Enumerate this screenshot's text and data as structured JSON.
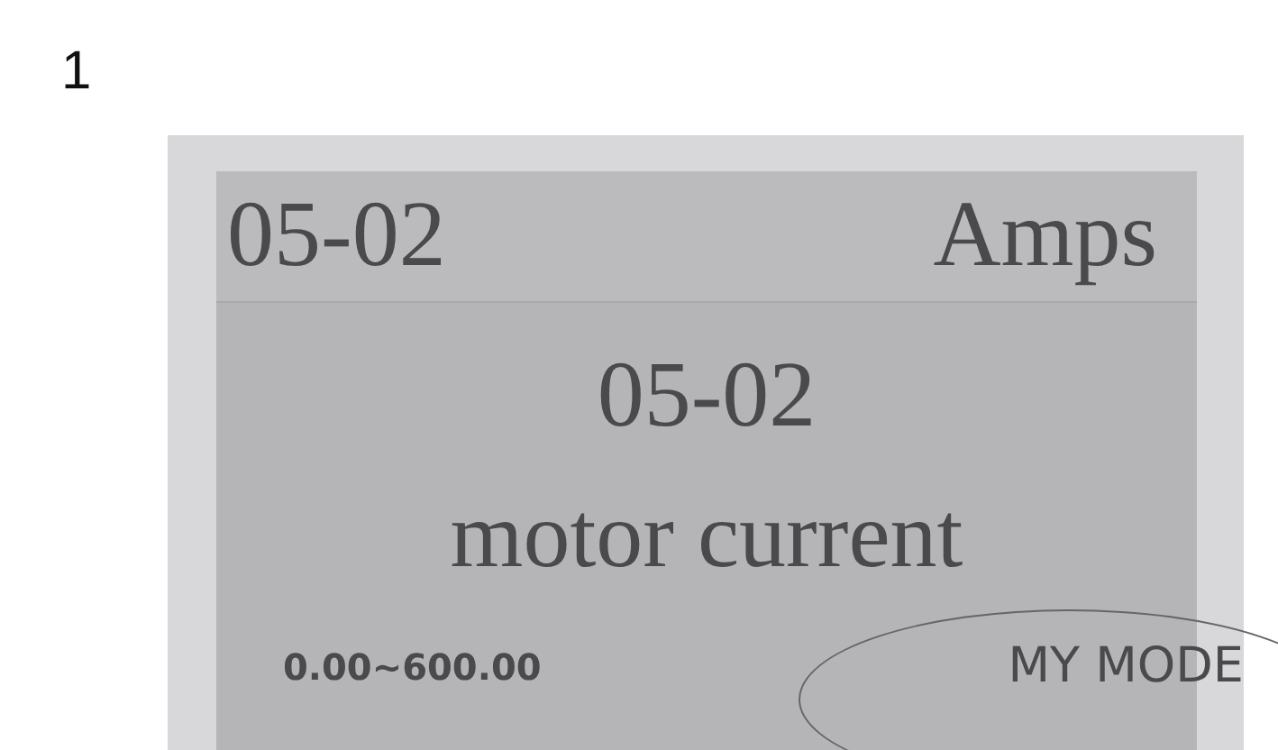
{
  "figure_number": "1",
  "display": {
    "header": {
      "code": "05-02",
      "unit": "Amps"
    },
    "parameter_code": "05-02",
    "parameter_name": "motor current",
    "range": "0.00~600.00",
    "mode": "MY MODE",
    "mode_circled": true
  }
}
